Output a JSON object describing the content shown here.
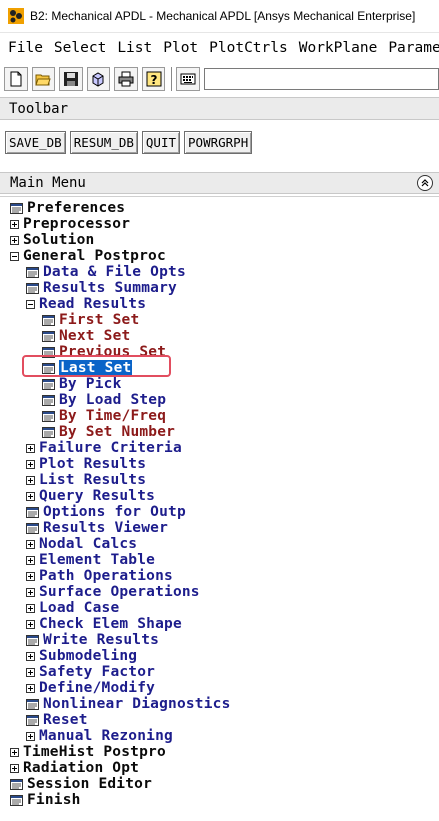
{
  "window": {
    "title": "B2: Mechanical APDL - Mechanical APDL [Ansys Mechanical Enterprise]"
  },
  "menubar": [
    "File",
    "Select",
    "List",
    "Plot",
    "PlotCtrls",
    "WorkPlane",
    "Paramet"
  ],
  "toolbar_icons": [
    "new-file-icon",
    "open-folder-icon",
    "save-icon",
    "cube-icon",
    "print-icon",
    "help-icon",
    "command-keyboard-icon"
  ],
  "command_input": {
    "value": ""
  },
  "toolbar": {
    "label": "Toolbar",
    "buttons": [
      "SAVE_DB",
      "RESUM_DB",
      "QUIT",
      "POWRGRPH"
    ]
  },
  "main_menu": {
    "title": "Main Menu",
    "items": [
      {
        "label": "Preferences",
        "icon": "menu-leaf-icon",
        "color": "black"
      },
      {
        "label": "Preprocessor",
        "icon": "expand",
        "color": "black"
      },
      {
        "label": "Solution",
        "icon": "expand",
        "color": "black"
      },
      {
        "label": "General Postproc",
        "icon": "collapse",
        "color": "black"
      },
      {
        "label": "Data & File Opts",
        "icon": "menu-leaf-icon",
        "color": "blue"
      },
      {
        "label": "Results Summary",
        "icon": "menu-leaf-icon",
        "color": "blue"
      },
      {
        "label": "Read Results",
        "icon": "collapse",
        "color": "blue"
      },
      {
        "label": "First Set",
        "icon": "menu-leaf-icon",
        "color": "red"
      },
      {
        "label": "Next Set",
        "icon": "menu-leaf-icon",
        "color": "red"
      },
      {
        "label": "Previous Set",
        "icon": "menu-leaf-icon",
        "color": "red"
      },
      {
        "label": "Last Set",
        "icon": "menu-leaf-icon",
        "color": "selected"
      },
      {
        "label": "By Pick",
        "icon": "menu-leaf-icon",
        "color": "blue"
      },
      {
        "label": "By Load Step",
        "icon": "menu-leaf-icon",
        "color": "blue"
      },
      {
        "label": "By Time/Freq",
        "icon": "menu-leaf-icon",
        "color": "red"
      },
      {
        "label": "By Set Number",
        "icon": "menu-leaf-icon",
        "color": "red"
      },
      {
        "label": "Failure Criteria",
        "icon": "expand",
        "color": "blue"
      },
      {
        "label": "Plot Results",
        "icon": "expand",
        "color": "blue"
      },
      {
        "label": "List Results",
        "icon": "expand",
        "color": "blue"
      },
      {
        "label": "Query Results",
        "icon": "expand",
        "color": "blue"
      },
      {
        "label": "Options for Outp",
        "icon": "menu-leaf-icon",
        "color": "blue"
      },
      {
        "label": "Results Viewer",
        "icon": "menu-leaf-icon",
        "color": "blue"
      },
      {
        "label": "Nodal Calcs",
        "icon": "expand",
        "color": "blue"
      },
      {
        "label": "Element Table",
        "icon": "expand",
        "color": "blue"
      },
      {
        "label": "Path Operations",
        "icon": "expand",
        "color": "blue"
      },
      {
        "label": "Surface Operations",
        "icon": "expand",
        "color": "blue"
      },
      {
        "label": "Load Case",
        "icon": "expand",
        "color": "blue"
      },
      {
        "label": "Check Elem Shape",
        "icon": "expand",
        "color": "blue"
      },
      {
        "label": "Write Results",
        "icon": "menu-leaf-icon",
        "color": "blue"
      },
      {
        "label": "Submodeling",
        "icon": "expand",
        "color": "blue"
      },
      {
        "label": "Safety Factor",
        "icon": "expand",
        "color": "blue"
      },
      {
        "label": "Define/Modify",
        "icon": "expand",
        "color": "blue"
      },
      {
        "label": "Nonlinear Diagnostics",
        "icon": "menu-leaf-icon",
        "color": "blue"
      },
      {
        "label": "Reset",
        "icon": "menu-leaf-icon",
        "color": "blue"
      },
      {
        "label": "Manual Rezoning",
        "icon": "expand",
        "color": "blue"
      },
      {
        "label": "TimeHist Postpro",
        "icon": "expand",
        "color": "black"
      },
      {
        "label": "Radiation Opt",
        "icon": "expand",
        "color": "black"
      },
      {
        "label": "Session Editor",
        "icon": "menu-leaf-icon",
        "color": "black"
      },
      {
        "label": "Finish",
        "icon": "menu-leaf-icon",
        "color": "black"
      }
    ]
  },
  "colors": {
    "highlight_box": "#e24d5f",
    "selection": "#0a64c8",
    "blue_text": "#1d1d8c",
    "red_text": "#8c1a1a"
  }
}
